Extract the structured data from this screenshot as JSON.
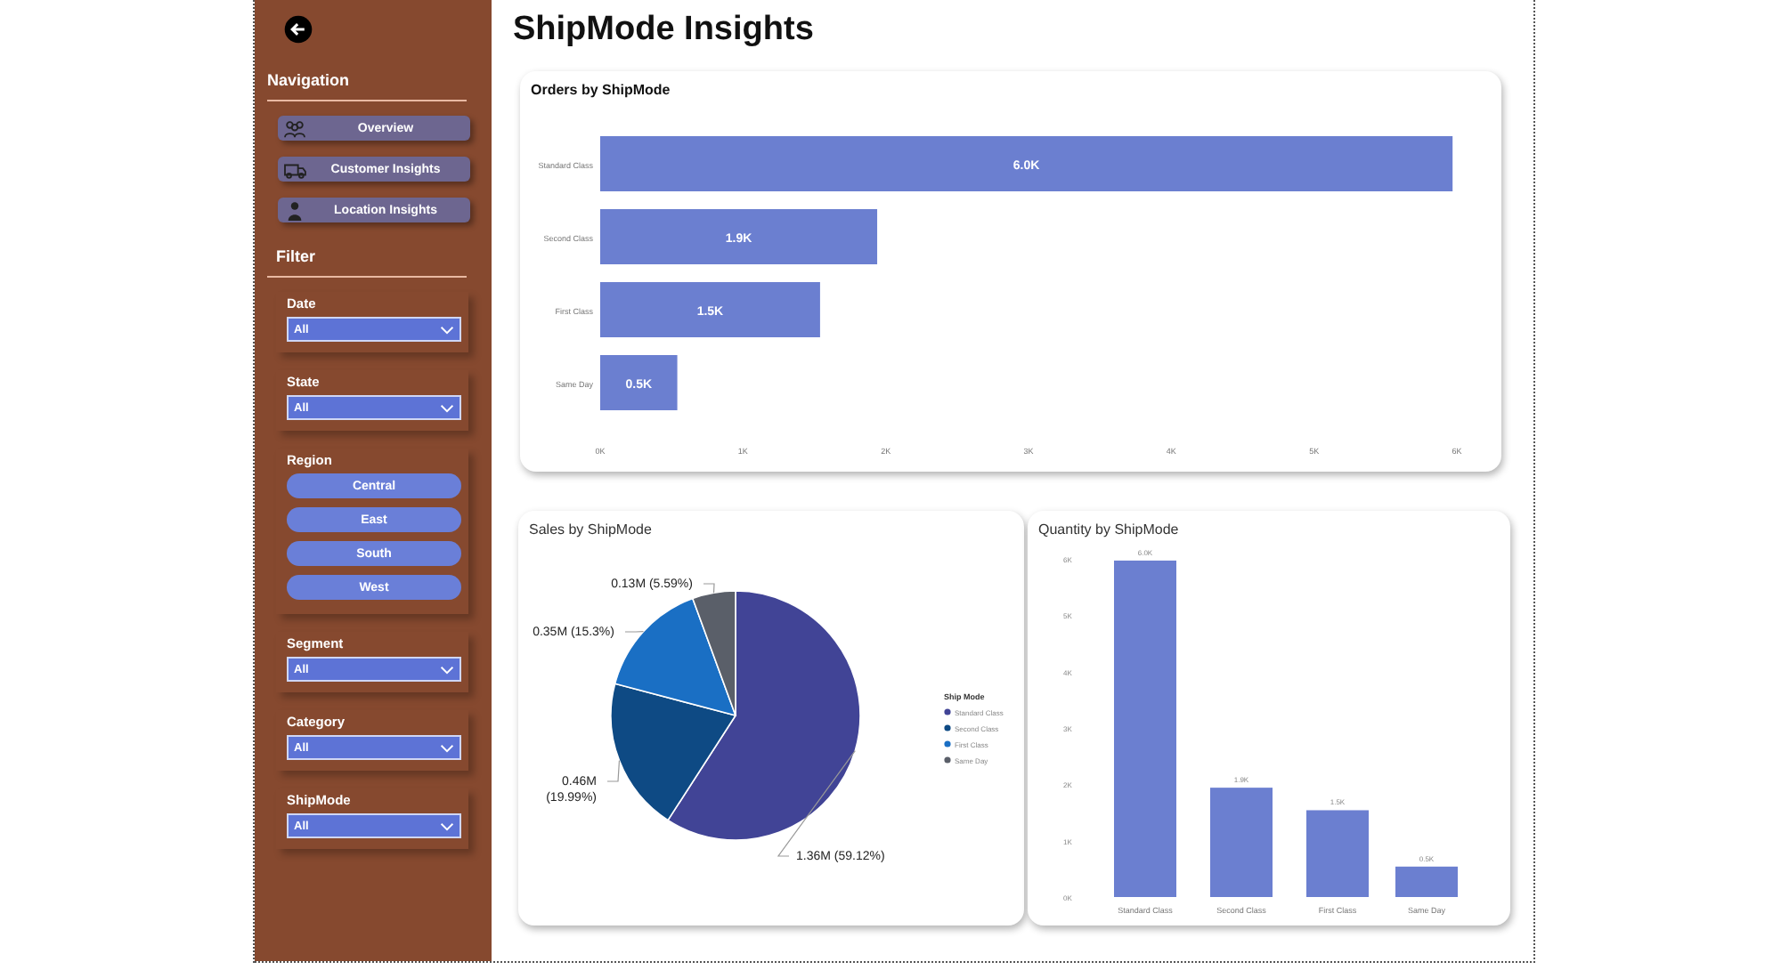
{
  "title": "ShipMode Insights",
  "sidebar": {
    "navigation_title": "Navigation",
    "nav_buttons": [
      {
        "label": "Overview",
        "kind": "people"
      },
      {
        "label": "Customer Insights",
        "kind": "truck"
      },
      {
        "label": "Location Insights",
        "kind": "person"
      }
    ],
    "filter_title": "Filter",
    "filters": [
      {
        "kind": "dropdown",
        "label": "Date",
        "value": "All"
      },
      {
        "kind": "dropdown",
        "label": "State",
        "value": "All"
      },
      {
        "kind": "tiles",
        "label": "Region",
        "tiles": [
          "Central",
          "East",
          "South",
          "West"
        ]
      },
      {
        "kind": "dropdown",
        "label": "Segment",
        "value": "All"
      },
      {
        "kind": "dropdown",
        "label": "Category",
        "value": "All"
      },
      {
        "kind": "dropdown",
        "label": "ShipMode",
        "value": "All"
      }
    ]
  },
  "orders_card": {
    "title": "Orders by ShipMode",
    "chart_data": {
      "type": "bar",
      "orientation": "horizontal",
      "categories": [
        "Standard Class",
        "Second Class",
        "First Class",
        "Same Day"
      ],
      "series": [
        {
          "color": "#6b7fd0",
          "values": [
            5.97,
            1.94,
            1.54,
            0.54
          ]
        }
      ],
      "xlim": [
        0,
        6
      ],
      "xticks": [
        {
          "value": 0,
          "label": "0K"
        },
        {
          "value": 1,
          "label": "1K"
        },
        {
          "value": 2,
          "label": "2K"
        },
        {
          "value": 3,
          "label": "3K"
        },
        {
          "value": 4,
          "label": "4K"
        },
        {
          "value": 5,
          "label": "5K"
        },
        {
          "value": 6,
          "label": "6K"
        }
      ],
      "value_labels": [
        "6.0K",
        "1.9K",
        "1.5K",
        "0.5K"
      ]
    }
  },
  "sales_card": {
    "title": "Sales by ShipMode",
    "chart_data": {
      "type": "pie",
      "categories": [
        "Standard Class",
        "Second Class",
        "First Class",
        "Same Day"
      ],
      "values": [
        59.12,
        19.99,
        15.3,
        5.59
      ],
      "value_labels": [
        "1.36M (59.12%)",
        "0.46M (19.99%)",
        "0.35M (15.3%)",
        "0.13M (5.59%)"
      ],
      "legend": {
        "title": "Ship Mode",
        "colors": [
          "#414496",
          "#0e4a84",
          "#1a6fc4",
          "#5a5f69"
        ]
      }
    }
  },
  "quantity_card": {
    "title": "Quantity by ShipMode",
    "chart_data": {
      "type": "bar",
      "orientation": "vertical",
      "categories": [
        "Standard Class",
        "Second Class",
        "First Class",
        "Same Day"
      ],
      "series": [
        {
          "color": "#6b7fd0",
          "values": [
            5.97,
            1.94,
            1.54,
            0.54
          ]
        }
      ],
      "ylim": [
        0,
        6
      ],
      "yticks": [
        {
          "value": 0,
          "label": "0K"
        },
        {
          "value": 1,
          "label": "1K"
        },
        {
          "value": 2,
          "label": "2K"
        },
        {
          "value": 3,
          "label": "3K"
        },
        {
          "value": 4,
          "label": "4K"
        },
        {
          "value": 5,
          "label": "5K"
        },
        {
          "value": 6,
          "label": "6K"
        }
      ],
      "value_labels": [
        "6.0K",
        "1.9K",
        "1.5K",
        "0.5K"
      ]
    }
  }
}
